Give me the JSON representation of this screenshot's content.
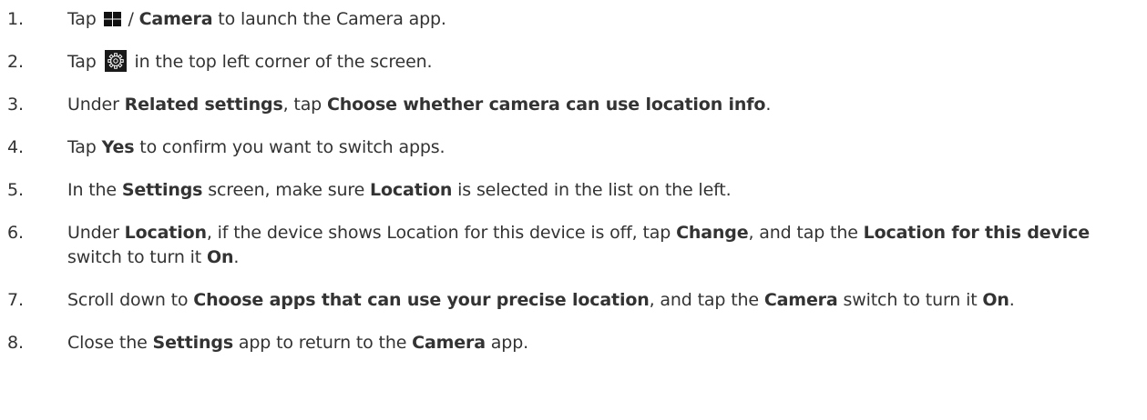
{
  "steps": [
    {
      "number": "1.",
      "parts": [
        {
          "t": "Tap "
        },
        {
          "icon": "windows-icon"
        },
        {
          "t": " / "
        },
        {
          "t": "Camera",
          "b": true
        },
        {
          "t": " to launch the Camera app."
        }
      ]
    },
    {
      "number": "2.",
      "parts": [
        {
          "t": "Tap "
        },
        {
          "icon": "settings-gear-icon"
        },
        {
          "t": " in the top left corner of the screen."
        }
      ]
    },
    {
      "number": "3.",
      "parts": [
        {
          "t": "Under "
        },
        {
          "t": "Related settings",
          "b": true
        },
        {
          "t": ", tap "
        },
        {
          "t": "Choose whether camera can use location info",
          "b": true
        },
        {
          "t": "."
        }
      ]
    },
    {
      "number": "4.",
      "parts": [
        {
          "t": "Tap "
        },
        {
          "t": "Yes",
          "b": true
        },
        {
          "t": " to confirm you want to switch apps."
        }
      ]
    },
    {
      "number": "5.",
      "parts": [
        {
          "t": "In the "
        },
        {
          "t": "Settings",
          "b": true
        },
        {
          "t": " screen, make sure "
        },
        {
          "t": "Location",
          "b": true
        },
        {
          "t": " is selected in the list on the left."
        }
      ]
    },
    {
      "number": "6.",
      "parts": [
        {
          "t": "Under "
        },
        {
          "t": "Location",
          "b": true
        },
        {
          "t": ", if the device shows Location for this device is off, tap "
        },
        {
          "t": "Change",
          "b": true
        },
        {
          "t": ", and tap the "
        },
        {
          "t": "Location for this device",
          "b": true
        },
        {
          "t": " switch to turn it "
        },
        {
          "t": "On",
          "b": true
        },
        {
          "t": "."
        }
      ]
    },
    {
      "number": "7.",
      "parts": [
        {
          "t": "Scroll down to "
        },
        {
          "t": "Choose apps that can use your precise location",
          "b": true
        },
        {
          "t": ", and tap the "
        },
        {
          "t": "Camera",
          "b": true
        },
        {
          "t": " switch to turn it "
        },
        {
          "t": "On",
          "b": true
        },
        {
          "t": "."
        }
      ]
    },
    {
      "number": "8.",
      "parts": [
        {
          "t": "Close the "
        },
        {
          "t": "Settings",
          "b": true
        },
        {
          "t": " app to return to the "
        },
        {
          "t": "Camera",
          "b": true
        },
        {
          "t": " app."
        }
      ]
    }
  ]
}
